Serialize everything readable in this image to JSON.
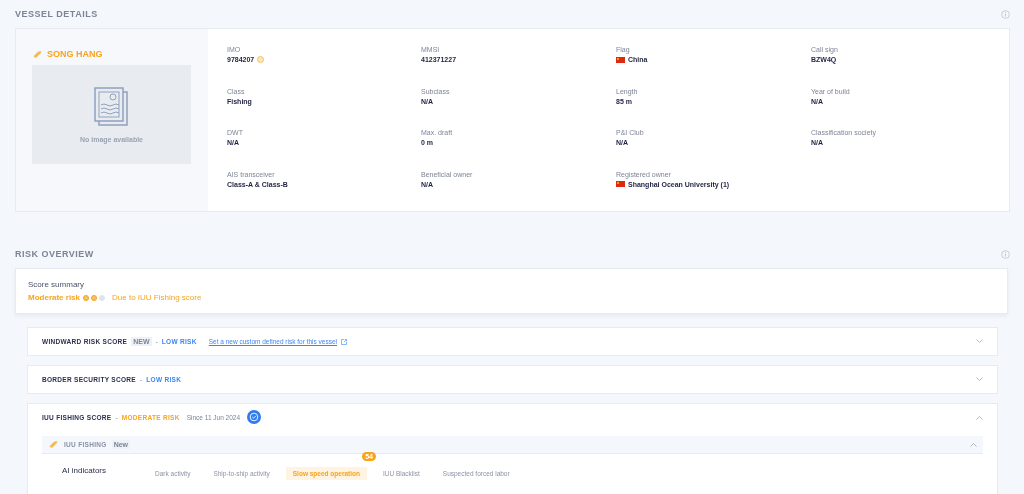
{
  "vessel_details": {
    "title": "VESSEL DETAILS",
    "vessel_name": "SONG HANG",
    "image_placeholder": "No image available",
    "fields": [
      {
        "label": "IMO",
        "value": "9784207",
        "kind": "status"
      },
      {
        "label": "MMSI",
        "value": "412371227",
        "kind": "plain"
      },
      {
        "label": "Flag",
        "value": "China",
        "kind": "flag"
      },
      {
        "label": "Call sign",
        "value": "BZW4Q",
        "kind": "plain"
      },
      {
        "label": "Class",
        "value": "Fishing",
        "kind": "plain"
      },
      {
        "label": "Subclass",
        "value": "N/A",
        "kind": "plain"
      },
      {
        "label": "Length",
        "value": "85 m",
        "kind": "plain"
      },
      {
        "label": "Year of build",
        "value": "N/A",
        "kind": "plain"
      },
      {
        "label": "DWT",
        "value": "N/A",
        "kind": "plain"
      },
      {
        "label": "Max. draft",
        "value": "0 m",
        "kind": "plain"
      },
      {
        "label": "P&I Club",
        "value": "N/A",
        "kind": "plain"
      },
      {
        "label": "Classification society",
        "value": "N/A",
        "kind": "plain"
      },
      {
        "label": "AIS transceiver",
        "value": "Class-A & Class-B",
        "kind": "plain"
      },
      {
        "label": "Beneficial owner",
        "value": "N/A",
        "kind": "plain"
      },
      {
        "label": "Registered owner",
        "value": "Shanghai Ocean University (1)",
        "kind": "flag"
      }
    ]
  },
  "risk_overview": {
    "title": "RISK OVERVIEW",
    "summary": {
      "label": "Score summary",
      "risk": "Moderate risk",
      "dots": [
        {
          "filled": true
        },
        {
          "filled": true
        },
        {
          "filled": false
        }
      ],
      "reason": "Due to IUU Fishing score"
    },
    "scores": [
      {
        "title": "WINDWARD RISK SCORE",
        "badge": "NEW",
        "separator": "-",
        "risk": "LOW RISK",
        "kind": "low",
        "link": "Set a new custom defined risk for this vessel",
        "expanded": false
      },
      {
        "title": "BORDER SECURITY SCORE",
        "separator": "-",
        "risk": "LOW RISK",
        "kind": "low",
        "expanded": false
      },
      {
        "title": "IUU FISHING SCORE",
        "separator": "-",
        "risk": "MODERATE RISK",
        "kind": "moderate",
        "since": "Since 11 Jun 2024",
        "verified": true,
        "expanded": true,
        "sub": {
          "title": "IUU FISHING",
          "badge": "New",
          "expanded": true,
          "indicators_label": "AI indicators",
          "indicators": [
            {
              "label": "Dark activity",
              "selected": false
            },
            {
              "label": "Ship-to-ship activity",
              "selected": false
            },
            {
              "label": "Slow speed operation",
              "selected": true,
              "count": "54"
            },
            {
              "label": "IUU Blacklist",
              "selected": false
            },
            {
              "label": "Suspected forced labor",
              "selected": false
            }
          ]
        }
      }
    ]
  }
}
